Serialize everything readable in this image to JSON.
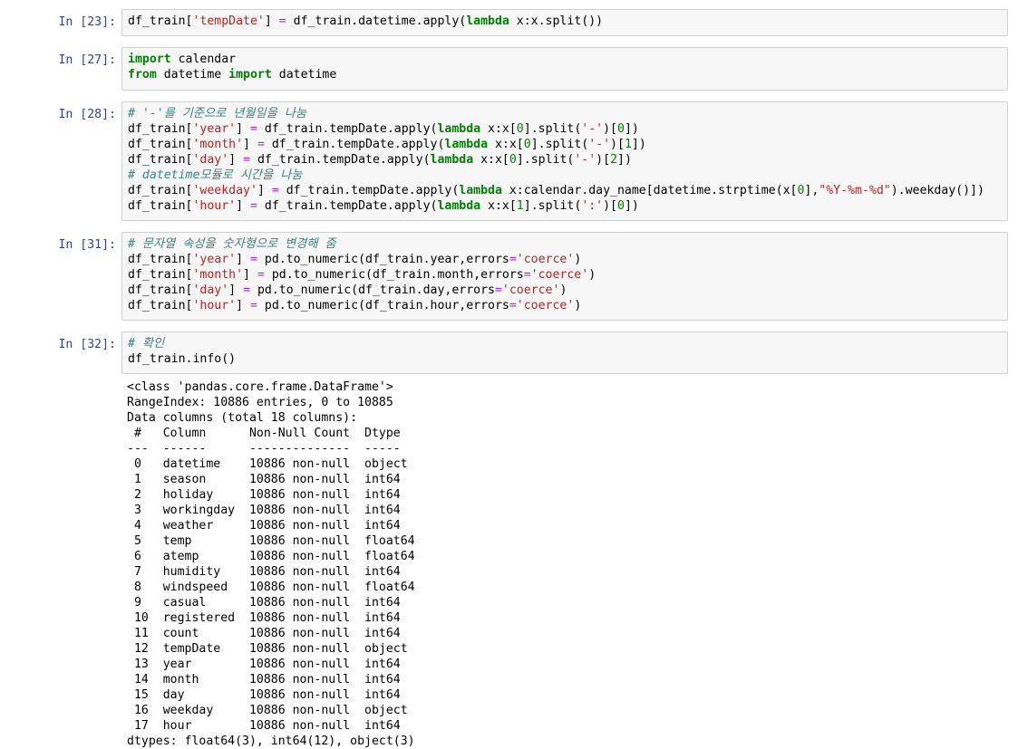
{
  "cells": [
    {
      "prompt": "In [23]:",
      "lines": [
        [
          [
            "df_train[",
            ""
          ],
          [
            "'tempDate'",
            "str"
          ],
          [
            "] ",
            ""
          ],
          [
            "=",
            "op"
          ],
          [
            " df_train.datetime.apply(",
            ""
          ],
          [
            "lambda",
            "kw"
          ],
          [
            " x:x.split())",
            ""
          ]
        ]
      ]
    },
    {
      "prompt": "In [27]:",
      "lines": [
        [
          [
            "import",
            "kw"
          ],
          [
            " calendar",
            ""
          ]
        ],
        [
          [
            "from",
            "kw"
          ],
          [
            " datetime ",
            ""
          ],
          [
            "import",
            "kw"
          ],
          [
            " datetime",
            ""
          ]
        ]
      ]
    },
    {
      "prompt": "In [28]:",
      "lines": [
        [
          [
            "# '-'를 기준으로 년월일을 나눔",
            "cm"
          ]
        ],
        [
          [
            "df_train[",
            ""
          ],
          [
            "'year'",
            "str"
          ],
          [
            "] ",
            ""
          ],
          [
            "=",
            "op"
          ],
          [
            " df_train.tempDate.apply(",
            ""
          ],
          [
            "lambda",
            "kw"
          ],
          [
            " x:x[",
            ""
          ],
          [
            "0",
            "num"
          ],
          [
            "].split(",
            ""
          ],
          [
            "'-'",
            "str"
          ],
          [
            ")[",
            ""
          ],
          [
            "0",
            "num"
          ],
          [
            "])",
            ""
          ]
        ],
        [
          [
            "df_train[",
            ""
          ],
          [
            "'month'",
            "str"
          ],
          [
            "] ",
            ""
          ],
          [
            "=",
            "op"
          ],
          [
            " df_train.tempDate.apply(",
            ""
          ],
          [
            "lambda",
            "kw"
          ],
          [
            " x:x[",
            ""
          ],
          [
            "0",
            "num"
          ],
          [
            "].split(",
            ""
          ],
          [
            "'-'",
            "str"
          ],
          [
            ")[",
            ""
          ],
          [
            "1",
            "num"
          ],
          [
            "])",
            ""
          ]
        ],
        [
          [
            "df_train[",
            ""
          ],
          [
            "'day'",
            "str"
          ],
          [
            "] ",
            ""
          ],
          [
            "=",
            "op"
          ],
          [
            " df_train.tempDate.apply(",
            ""
          ],
          [
            "lambda",
            "kw"
          ],
          [
            " x:x[",
            ""
          ],
          [
            "0",
            "num"
          ],
          [
            "].split(",
            ""
          ],
          [
            "'-'",
            "str"
          ],
          [
            ")[",
            ""
          ],
          [
            "2",
            "num"
          ],
          [
            "])",
            ""
          ]
        ],
        [
          [
            "# datetime모듈로 시간을 나눔",
            "cm"
          ]
        ],
        [
          [
            "df_train[",
            ""
          ],
          [
            "'weekday'",
            "str"
          ],
          [
            "] ",
            ""
          ],
          [
            "=",
            "op"
          ],
          [
            " df_train.tempDate.apply(",
            ""
          ],
          [
            "lambda",
            "kw"
          ],
          [
            " x:calendar.day_name[datetime.strptime(x[",
            ""
          ],
          [
            "0",
            "num"
          ],
          [
            "],",
            ""
          ],
          [
            "\"%Y-%m-%d\"",
            "str"
          ],
          [
            ").weekday()])",
            ""
          ]
        ],
        [
          [
            "df_train[",
            ""
          ],
          [
            "'hour'",
            "str"
          ],
          [
            "] ",
            ""
          ],
          [
            "=",
            "op"
          ],
          [
            " df_train.tempDate.apply(",
            ""
          ],
          [
            "lambda",
            "kw"
          ],
          [
            " x:x[",
            ""
          ],
          [
            "1",
            "num"
          ],
          [
            "].split(",
            ""
          ],
          [
            "':'",
            "str"
          ],
          [
            ")[",
            ""
          ],
          [
            "0",
            "num"
          ],
          [
            "])",
            ""
          ]
        ]
      ]
    },
    {
      "prompt": "In [31]:",
      "lines": [
        [
          [
            "# 문자열 속성을 숫자형으로 변경해 줌",
            "cm"
          ]
        ],
        [
          [
            "df_train[",
            ""
          ],
          [
            "'year'",
            "str"
          ],
          [
            "] ",
            ""
          ],
          [
            "=",
            "op"
          ],
          [
            " pd.to_numeric(df_train.year,errors",
            ""
          ],
          [
            "=",
            "op"
          ],
          [
            "'coerce'",
            "str"
          ],
          [
            ")",
            ""
          ]
        ],
        [
          [
            "df_train[",
            ""
          ],
          [
            "'month'",
            "str"
          ],
          [
            "] ",
            ""
          ],
          [
            "=",
            "op"
          ],
          [
            " pd.to_numeric(df_train.month,errors",
            ""
          ],
          [
            "=",
            "op"
          ],
          [
            "'coerce'",
            "str"
          ],
          [
            ")",
            ""
          ]
        ],
        [
          [
            "df_train[",
            ""
          ],
          [
            "'day'",
            "str"
          ],
          [
            "] ",
            ""
          ],
          [
            "=",
            "op"
          ],
          [
            " pd.to_numeric(df_train.day,errors",
            ""
          ],
          [
            "=",
            "op"
          ],
          [
            "'coerce'",
            "str"
          ],
          [
            ")",
            ""
          ]
        ],
        [
          [
            "df_train[",
            ""
          ],
          [
            "'hour'",
            "str"
          ],
          [
            "] ",
            ""
          ],
          [
            "=",
            "op"
          ],
          [
            " pd.to_numeric(df_train.hour,errors",
            ""
          ],
          [
            "=",
            "op"
          ],
          [
            "'coerce'",
            "str"
          ],
          [
            ")",
            ""
          ]
        ]
      ]
    },
    {
      "prompt": "In [32]:",
      "lines": [
        [
          [
            "# 확인",
            "cm"
          ]
        ],
        [
          [
            "df_train.info()",
            ""
          ]
        ]
      ]
    }
  ],
  "output": [
    "<class 'pandas.core.frame.DataFrame'>",
    "RangeIndex: 10886 entries, 0 to 10885",
    "Data columns (total 18 columns):",
    " #   Column      Non-Null Count  Dtype ",
    "---  ------      --------------  ----- ",
    " 0   datetime    10886 non-null  object",
    " 1   season      10886 non-null  int64 ",
    " 2   holiday     10886 non-null  int64 ",
    " 3   workingday  10886 non-null  int64 ",
    " 4   weather     10886 non-null  int64 ",
    " 5   temp        10886 non-null  float64",
    " 6   atemp       10886 non-null  float64",
    " 7   humidity    10886 non-null  int64 ",
    " 8   windspeed   10886 non-null  float64",
    " 9   casual      10886 non-null  int64 ",
    " 10  registered  10886 non-null  int64 ",
    " 11  count       10886 non-null  int64 ",
    " 12  tempDate    10886 non-null  object",
    " 13  year        10886 non-null  int64 ",
    " 14  month       10886 non-null  int64 ",
    " 15  day         10886 non-null  int64 ",
    " 16  weekday     10886 non-null  object",
    " 17  hour        10886 non-null  int64 ",
    "dtypes: float64(3), int64(12), object(3)"
  ]
}
